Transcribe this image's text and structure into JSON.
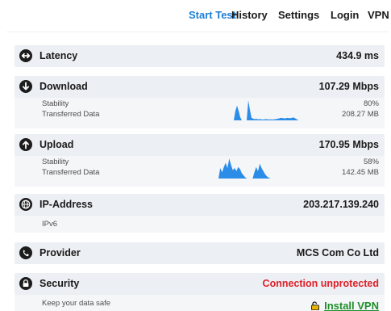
{
  "nav": [
    {
      "label": "Start Test",
      "active": true
    },
    {
      "label": "History",
      "active": false
    },
    {
      "label": "Settings",
      "active": false
    },
    {
      "label": "Login",
      "active": false
    },
    {
      "label": "VPN",
      "active": false
    }
  ],
  "latency": {
    "title": "Latency",
    "value": "434.9 ms",
    "icon": "arrows-horizontal-icon"
  },
  "download": {
    "title": "Download",
    "value": "107.29 Mbps",
    "icon": "arrow-down-icon",
    "stability_label": "Stability",
    "stability_value": "80%",
    "transferred_label": "Transferred Data",
    "transferred_value": "208.27 MB",
    "sparkline": [
      0,
      0,
      0,
      0,
      0,
      0.45,
      0.7,
      0.45,
      0.15,
      0,
      0,
      0,
      0,
      0.95,
      0.5,
      0.12,
      0.08,
      0.06,
      0.07,
      0.05,
      0.06,
      0.05,
      0.04,
      0.05,
      0.06,
      0.05,
      0.04,
      0.05,
      0.04,
      0.05,
      0.06,
      0.07,
      0.09,
      0.12,
      0.11,
      0.1,
      0.09,
      0.12,
      0.11,
      0.1,
      0.12,
      0.14,
      0.1,
      0.05,
      0.02
    ]
  },
  "upload": {
    "title": "Upload",
    "value": "170.95 Mbps",
    "icon": "arrow-up-icon",
    "stability_label": "Stability",
    "stability_value": "58%",
    "transferred_label": "Transferred Data",
    "transferred_value": "142.45 MB",
    "sparkline": [
      0,
      0.5,
      0.3,
      0.55,
      0.75,
      0.5,
      0.95,
      0.65,
      0.4,
      0.5,
      0.35,
      0.55,
      0.45,
      0.25,
      0.15,
      0.05,
      0,
      0,
      0,
      0,
      0.3,
      0.55,
      0.35,
      0.7,
      0.5,
      0.35,
      0.2,
      0.1,
      0.04,
      0,
      0,
      0,
      0,
      0,
      0,
      0,
      0,
      0,
      0,
      0,
      0,
      0,
      0,
      0,
      0
    ]
  },
  "ip": {
    "title": "IP-Address",
    "value": "203.217.139.240",
    "sub": "IPv6",
    "icon": "globe-icon"
  },
  "provider": {
    "title": "Provider",
    "value": "MCS Com Co Ltd",
    "icon": "phone-icon"
  },
  "security": {
    "title": "Security",
    "value": "Connection unprotected",
    "icon": "lock-icon",
    "sub": "Keep your data safe",
    "cta": "Install VPN",
    "cta_icon": "lock-open-icon"
  },
  "colors": {
    "accent": "#1d7fd6",
    "chart": "#2b8de8",
    "warning": "#e0202a",
    "vpn_green": "#1e8f2b",
    "vpn_lock": "#e8b400"
  }
}
